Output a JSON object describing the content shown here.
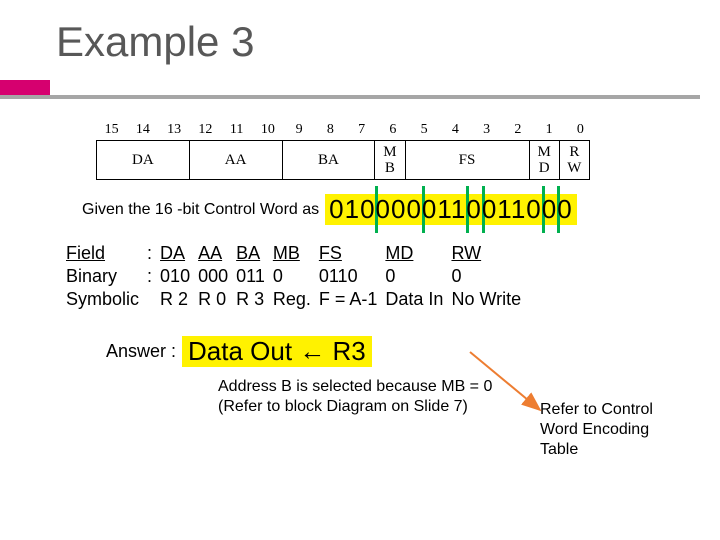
{
  "title": "Example 3",
  "bit_diagram": {
    "bit_numbers": [
      "15",
      "14",
      "13",
      "12",
      "11",
      "10",
      "9",
      "8",
      "7",
      "6",
      "5",
      "4",
      "3",
      "2",
      "1",
      "0"
    ],
    "fields": [
      {
        "label": "DA",
        "bits": 3
      },
      {
        "label": "AA",
        "bits": 3
      },
      {
        "label": "BA",
        "bits": 3
      },
      {
        "label": "M\nB",
        "bits": 1
      },
      {
        "label": "FS",
        "bits": 4
      },
      {
        "label": "M\nD",
        "bits": 1
      },
      {
        "label": "R\nW",
        "bits": 1
      }
    ]
  },
  "given_label": "Given the 16 -bit Control Word as",
  "control_word": "0100000110011000",
  "separators_after_index": [
    3,
    6,
    9,
    10,
    14,
    15
  ],
  "fields_table": {
    "rows": [
      {
        "lh": "Field",
        "colon": ":",
        "c1": "DA",
        "c2": "AA",
        "c3": "BA",
        "c4": "MB",
        "c5": "FS",
        "c6": "MD",
        "c7": "RW",
        "underline": true
      },
      {
        "lh": "Binary",
        "colon": ":",
        "c1": "010",
        "c2": "000",
        "c3": "011",
        "c4": "0",
        "c5": "0110",
        "c6": "0",
        "c7": "0"
      },
      {
        "lh": "Symbolic",
        "colon": "",
        "c1": "R 2",
        "c2": "R 0",
        "c3": "R 3",
        "c4": "Reg.",
        "c5": "F = A-1",
        "c6": "Data In",
        "c7": "No Write"
      }
    ]
  },
  "answer": {
    "label": "Answer :",
    "text": "Data Out ← R3"
  },
  "refer_note": "Refer to Control Word Encoding Table",
  "note2_line1": "Address B is selected because MB = 0",
  "note2_line2": "(Refer to block Diagram on Slide 7)"
}
